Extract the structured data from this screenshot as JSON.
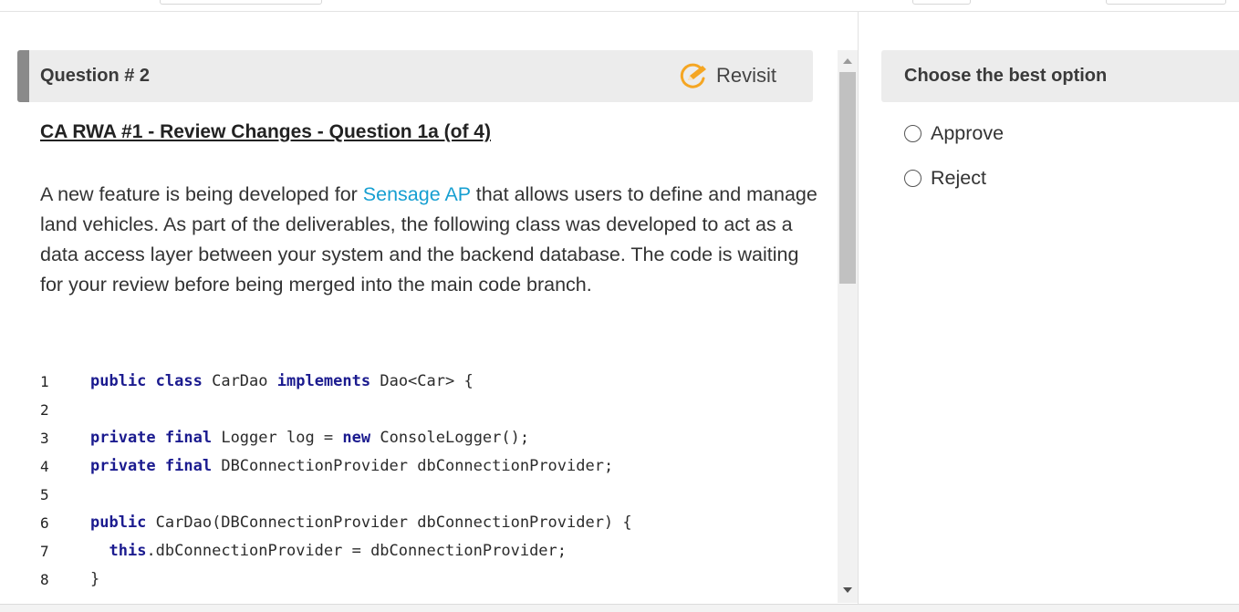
{
  "question": {
    "number_label": "Question # 2",
    "revisit_label": "Revisit",
    "subtitle": "CA RWA #1 - Review Changes - Question 1a (of 4)",
    "description": {
      "part1": "A new feature is being developed for ",
      "link": "Sensage AP",
      "part2": " that allows users to define and manage land vehicles. As part of the deliverables, the following class was developed to act as a data access layer between your system and the backend database. The code is waiting for your review before being merged into the main code branch."
    },
    "code_lines": [
      {
        "n": "1",
        "text": "public class CarDao implements Dao<Car> {"
      },
      {
        "n": "2",
        "text": ""
      },
      {
        "n": "3",
        "text": "private final Logger log = new ConsoleLogger();"
      },
      {
        "n": "4",
        "text": "private final DBConnectionProvider dbConnectionProvider;"
      },
      {
        "n": "5",
        "text": ""
      },
      {
        "n": "6",
        "text": "public CarDao(DBConnectionProvider dbConnectionProvider) {"
      },
      {
        "n": "7",
        "text": "  this.dbConnectionProvider = dbConnectionProvider;"
      },
      {
        "n": "8",
        "text": "}"
      }
    ]
  },
  "options_panel": {
    "title": "Choose the best option",
    "options": [
      {
        "label": "Approve"
      },
      {
        "label": "Reject"
      }
    ]
  },
  "colors": {
    "link": "#169fd1",
    "keyword": "#1b1b8f",
    "revisit_icon": "#f5a623",
    "header_bg": "#ececec",
    "header_accent": "#8a8a8a"
  },
  "icons": {
    "revisit": "revisit-pencil-circle-icon"
  }
}
